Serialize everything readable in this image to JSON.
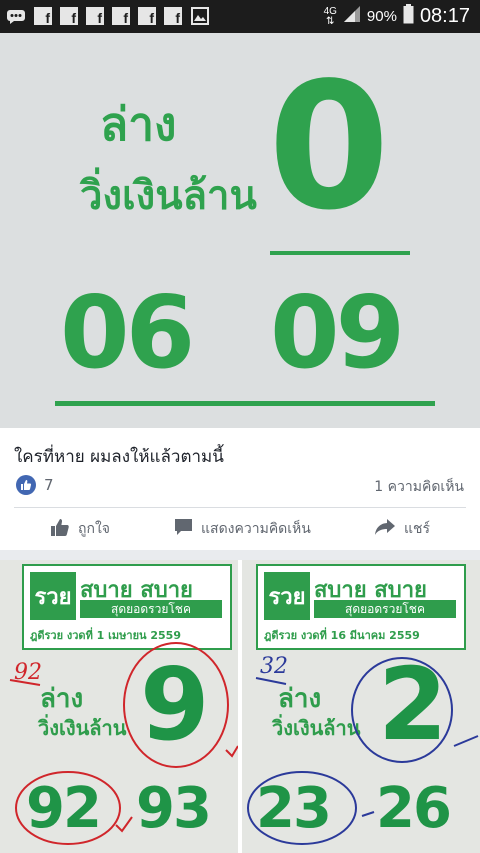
{
  "status_bar": {
    "notification_icons": [
      "messages-icon",
      "facebook-icon",
      "facebook-icon",
      "facebook-icon",
      "facebook-icon",
      "facebook-icon",
      "facebook-icon",
      "image-icon"
    ],
    "network": "4G",
    "battery": "90%",
    "time": "08:17"
  },
  "post": {
    "image": {
      "label_lower": "ล่าง",
      "label_run": "วิ่งเงินล้าน",
      "main_digit": "0",
      "pair_1": "06",
      "pair_2": "09"
    },
    "caption": "ใครที่หาย ผมลงให้แล้วตามนี้",
    "like_count": "7",
    "comment_count": "1 ความคิดเห็น",
    "actions": {
      "like": "ถูกใจ",
      "comment": "แสดงความคิดเห็น",
      "share": "แชร์"
    }
  },
  "next_post": {
    "tiles": [
      {
        "brand": "สบาย สบาย",
        "logo": "รวย",
        "slogan": "สุดยอดรวยโชค",
        "draw": "ฎดีรวย งวดที่ 1 เมษายน 2559",
        "label_lower": "ล่าง",
        "label_run": "วิ่งเงินล้าน",
        "handwritten": "92",
        "digit": "9",
        "pair_1": "92",
        "pair_2": "93",
        "ink_color": "#d0262b"
      },
      {
        "brand": "สบาย สบาย",
        "logo": "รวย",
        "slogan": "สุดยอดรวยโชค",
        "draw": "ฎดีรวย งวดที่ 16 มีนาคม 2559",
        "label_lower": "ล่าง",
        "label_run": "วิ่งเงินล้าน",
        "handwritten": "32",
        "digit": "2",
        "pair_1": "23",
        "pair_2": "26",
        "ink_color": "#2b3a9a"
      }
    ]
  },
  "colors": {
    "print_green": "#2fa24e",
    "facebook_blue": "#4267b2",
    "meta_gray": "#616770"
  }
}
